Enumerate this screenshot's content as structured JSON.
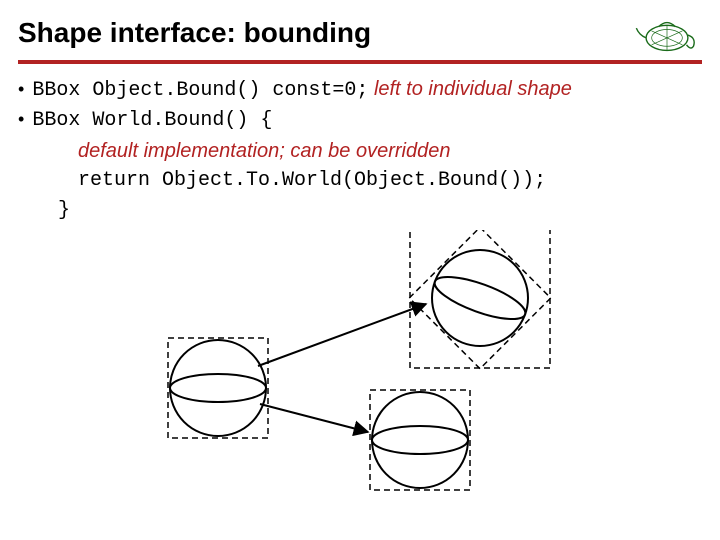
{
  "title": "Shape interface: bounding",
  "bullets": [
    {
      "code": "BBox Object.Bound() const=0;",
      "note": "left to individual shape"
    },
    {
      "code": "BBox World.Bound() {",
      "note": ""
    }
  ],
  "body": {
    "comment": "default implementation; can be overridden",
    "returnLine": "return Object.To.World(Object.Bound());",
    "close": "}"
  }
}
